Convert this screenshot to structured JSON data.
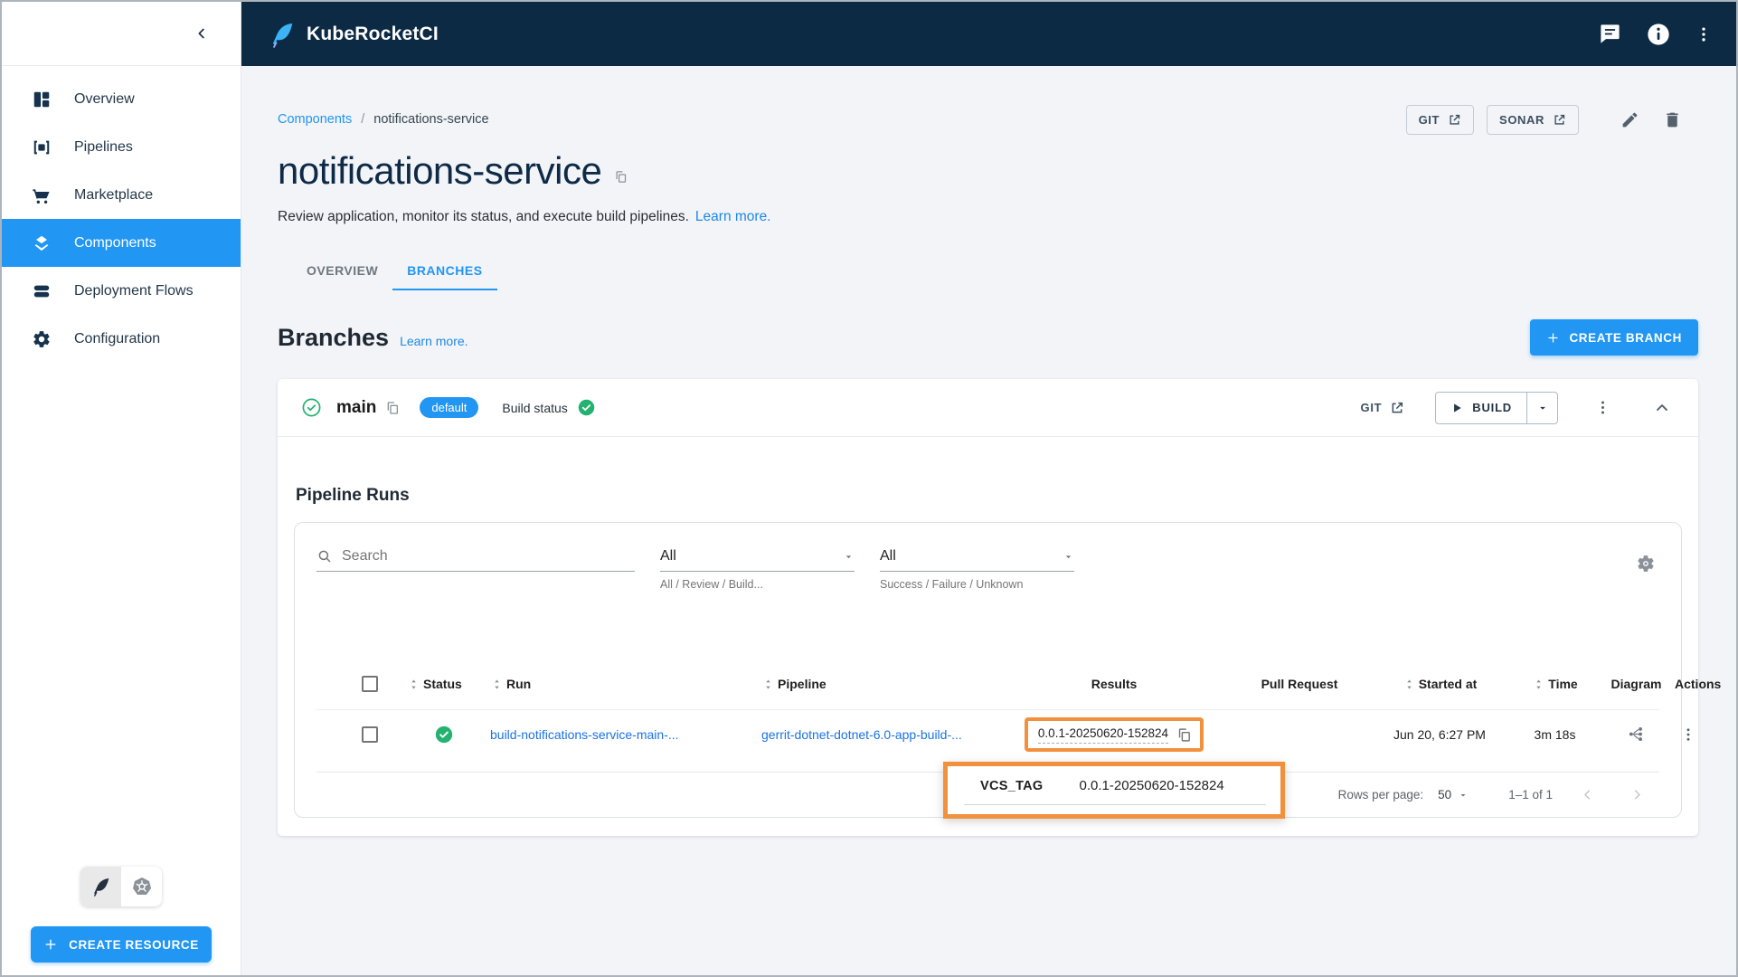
{
  "topbar": {
    "app_name": "KubeRocketCI"
  },
  "sidebar": {
    "items": [
      {
        "label": "Overview"
      },
      {
        "label": "Pipelines"
      },
      {
        "label": "Marketplace"
      },
      {
        "label": "Components"
      },
      {
        "label": "Deployment Flows"
      },
      {
        "label": "Configuration"
      }
    ],
    "create_resource_label": "CREATE RESOURCE"
  },
  "header": {
    "breadcrumb_parent": "Components",
    "breadcrumb_separator": "/",
    "breadcrumb_current": "notifications-service",
    "title": "notifications-service",
    "description": "Review application, monitor its status, and execute build pipelines.",
    "learn_more_label": "Learn more.",
    "git_button_label": "GIT",
    "sonar_button_label": "SONAR"
  },
  "tabs": {
    "overview": "OVERVIEW",
    "branches": "BRANCHES"
  },
  "branches_section": {
    "heading": "Branches",
    "learn_more_label": "Learn more.",
    "create_branch_label": "CREATE BRANCH",
    "branch": {
      "name": "main",
      "badge": "default",
      "build_status_label": "Build status",
      "git_label": "GIT",
      "build_label": "BUILD"
    }
  },
  "pipeline_runs": {
    "heading": "Pipeline Runs",
    "search_placeholder": "Search",
    "filter_type": {
      "value": "All",
      "helper": "All / Review / Build..."
    },
    "filter_status": {
      "value": "All",
      "helper": "Success / Failure / Unknown"
    },
    "columns": {
      "status": "Status",
      "run": "Run",
      "pipeline": "Pipeline",
      "results": "Results",
      "pull_request": "Pull Request",
      "started_at": "Started at",
      "time": "Time",
      "diagram": "Diagram",
      "actions": "Actions"
    },
    "row": {
      "status": "success",
      "run": "build-notifications-service-main-...",
      "pipeline": "gerrit-dotnet-dotnet-6.0-app-build-...",
      "results": "0.0.1-20250620-152824",
      "started_at": "Jun 20, 6:27 PM",
      "time": "3m 18s"
    },
    "pagination": {
      "rows_per_page_label": "Rows per page:",
      "rows_per_page_value": "50",
      "range_label": "1–1 of 1"
    }
  },
  "tooltip": {
    "key": "VCS_TAG",
    "value": "0.0.1-20250620-152824"
  },
  "colors": {
    "accent_blue": "#2196f3",
    "topbar_navy": "#0c2a44",
    "success_green": "#24b271",
    "annotation_orange": "#f2913d",
    "link_blue": "#1a73e8"
  }
}
